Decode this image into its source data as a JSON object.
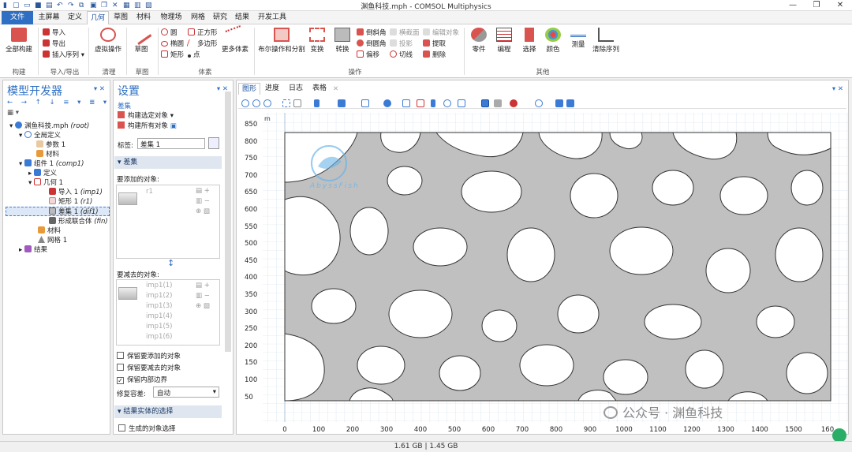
{
  "window": {
    "title": "渊鱼科技.mph - COMSOL Multiphysics"
  },
  "menu_tabs": [
    "文件",
    "主屏幕",
    "定义",
    "几何",
    "草图",
    "材料",
    "物理场",
    "网格",
    "研究",
    "结果",
    "开发工具"
  ],
  "ribbon": {
    "build_all": "全部构建",
    "import": "导入",
    "export": "导出",
    "insert_sequence": "插入序列",
    "virtual_ops": "虚拟操作",
    "sketch": "草图",
    "circle": "圆",
    "square": "正方形",
    "ellipse": "椭圆",
    "polygon": "多边形",
    "rectangle": "矩形",
    "point": "点",
    "more_primitives": "更多体素",
    "boolean_partition": "布尔操作和分割",
    "transform": "变换",
    "convert": "转换",
    "chamfer": "倒斜角",
    "fillet": "倒圆角",
    "offset": "偏移",
    "tangent": "切线",
    "cross_section": "横截面",
    "projection": "投影",
    "edit_object": "编辑对象",
    "extract": "提取",
    "delete": "删除",
    "parts": "零件",
    "programming": "编程",
    "select": "选择",
    "color": "颜色",
    "measure": "测量",
    "clear_sequence": "清除序列",
    "groups": [
      "构建",
      "导入/导出",
      "清理",
      "草图",
      "体素",
      "操作",
      "其他"
    ]
  },
  "model_builder": {
    "title": "模型开发器",
    "tree": [
      {
        "label": "渊鱼科技.mph",
        "tag": "(root)"
      },
      {
        "label": "全局定义",
        "tag": ""
      },
      {
        "label": "参数 1",
        "tag": ""
      },
      {
        "label": "材料",
        "tag": ""
      },
      {
        "label": "组件 1",
        "tag": "(comp1)"
      },
      {
        "label": "定义",
        "tag": ""
      },
      {
        "label": "几何 1",
        "tag": ""
      },
      {
        "label": "导入 1",
        "tag": "(imp1)"
      },
      {
        "label": "矩形 1",
        "tag": "(r1)"
      },
      {
        "label": "差集 1",
        "tag": "(dif1)"
      },
      {
        "label": "形成联合体",
        "tag": "(fin)"
      },
      {
        "label": "材料",
        "tag": ""
      },
      {
        "label": "网格 1",
        "tag": ""
      },
      {
        "label": "结果",
        "tag": ""
      }
    ]
  },
  "settings": {
    "title": "设置",
    "subtitle": "差集",
    "build_selected": "构建选定对象",
    "build_all_objects": "构建所有对象",
    "label_caption": "标签:",
    "label_value": "差集 1",
    "section_difference": "差集",
    "add_objects": "要添加的对象:",
    "add_items": [
      "r1"
    ],
    "subtract_objects": "要减去的对象:",
    "subtract_items": [
      "imp1(1)",
      "imp1(2)",
      "imp1(3)",
      "imp1(4)",
      "imp1(5)",
      "imp1(6)"
    ],
    "keep_input_add": "保留要添加的对象",
    "keep_input_sub": "保留要减去的对象",
    "keep_interior": "保留内部边界",
    "repair_tol_label": "修复容差:",
    "repair_tol_value": "自动",
    "section_result": "结果实体的选择",
    "create_selection": "生成的对象选择"
  },
  "graphics": {
    "tabs": [
      "图形",
      "进度",
      "日志",
      "表格"
    ],
    "unit": "m",
    "x_ticks": [
      "0",
      "100",
      "200",
      "300",
      "400",
      "500",
      "600",
      "700",
      "800",
      "900",
      "1000",
      "1100",
      "1200",
      "1300",
      "1400",
      "1500",
      "160"
    ],
    "y_ticks": [
      "850",
      "800",
      "750",
      "700",
      "650",
      "600",
      "550",
      "500",
      "450",
      "400",
      "350",
      "300",
      "250",
      "200",
      "150",
      "100",
      "50"
    ]
  },
  "watermark": {
    "brand": "AbyssFish",
    "account": "公众号 · 渊鱼科技"
  },
  "status": {
    "memory": "1.61 GB | 1.45 GB"
  },
  "colors": {
    "accent": "#2e6fc3",
    "geometry": "#c0c0c0",
    "grid": "#c9dbe9"
  }
}
